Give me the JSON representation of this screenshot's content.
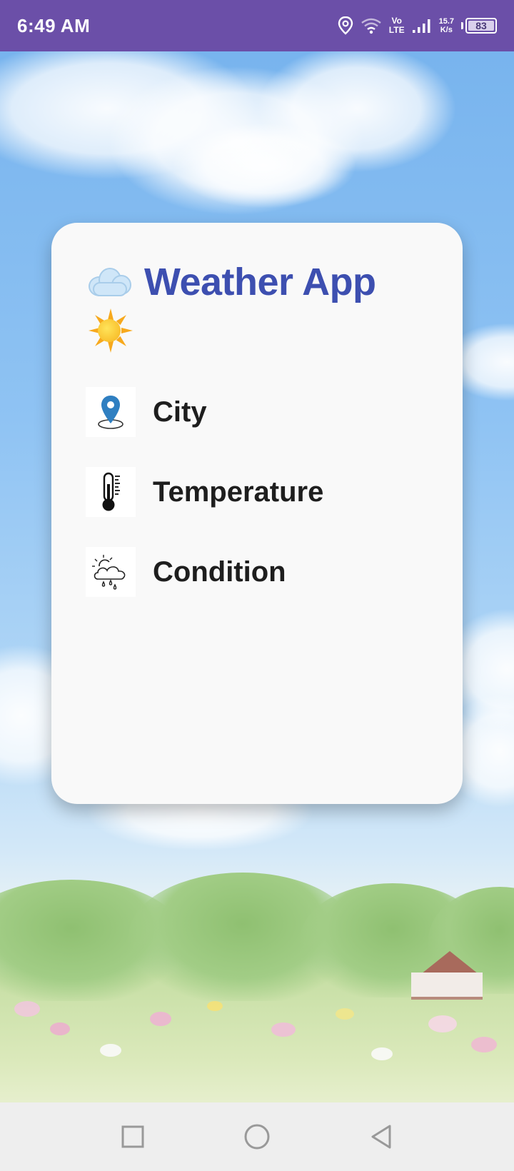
{
  "status_bar": {
    "time": "6:49 AM",
    "network_label": "Vo\nLTE",
    "net_speed_value": "15.7",
    "net_speed_unit": "K/s",
    "battery": "83",
    "icons": [
      "location-icon",
      "wifi-icon",
      "volte-icon",
      "signal-icon",
      "battery-icon"
    ],
    "background": "#6b4fa8"
  },
  "card": {
    "title": "Weather App",
    "title_color": "#3d4fb0",
    "title_icons": [
      "cloud-emoji-icon",
      "sun-emoji-icon"
    ],
    "rows": [
      {
        "label": "City",
        "icon": "location-pin-icon"
      },
      {
        "label": "Temperature",
        "icon": "thermometer-icon"
      },
      {
        "label": "Condition",
        "icon": "partly-cloudy-rain-icon"
      }
    ]
  },
  "nav_bar": {
    "buttons": [
      "recents-square-icon",
      "home-circle-icon",
      "back-triangle-icon"
    ]
  }
}
